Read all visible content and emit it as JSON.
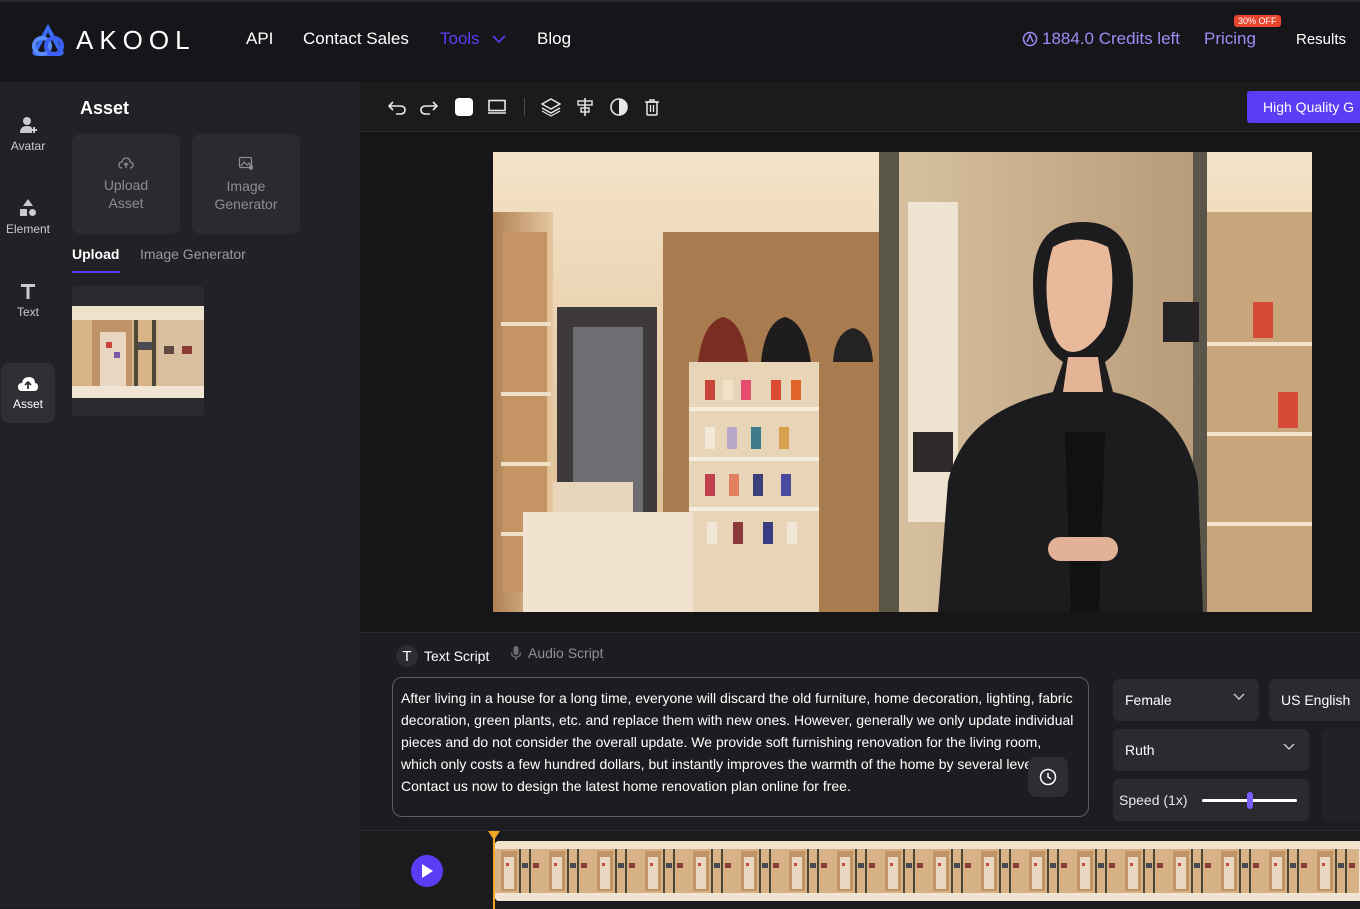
{
  "topbar": {
    "logo_text": "AKOOL",
    "nav": {
      "api": "API",
      "contact": "Contact Sales",
      "tools": "Tools",
      "blog": "Blog"
    },
    "credits": "1884.0 Credits left",
    "pricing": "Pricing",
    "pricing_badge": "30% OFF",
    "results": "Results"
  },
  "rail": {
    "items": [
      {
        "label": "Avatar",
        "icon": "avatar-icon"
      },
      {
        "label": "Element",
        "icon": "shapes-icon"
      },
      {
        "label": "Text",
        "icon": "text-icon"
      },
      {
        "label": "Asset",
        "icon": "cloud-upload-icon"
      }
    ]
  },
  "panel": {
    "title": "Asset",
    "cards": {
      "upload_l1": "Upload",
      "upload_l2": "Asset",
      "gen_l1": "Image",
      "gen_l2": "Generator"
    },
    "tabs": {
      "upload": "Upload",
      "image_gen": "Image Generator"
    }
  },
  "toolbar": {
    "hq_label": "High Quality G"
  },
  "script": {
    "tab_text": "Text Script",
    "tab_audio": "Audio Script",
    "text": "After living in a house for a long time, everyone will discard the old furniture, home decoration, lighting, fabric decoration, green plants, etc. and replace them with new ones. However, generally we only update individual pieces and do not consider the overall update. We provide soft furnishing renovation for the living room, which only costs a few hundred dollars, but instantly improves the warmth of the home by several levels! Contact us now to design the latest home renovation plan online for free."
  },
  "voice": {
    "gender": "Female",
    "language": "US English",
    "voice_name": "Ruth",
    "speed_label": "Speed (1x)",
    "speed_fraction": 0.5
  },
  "colors": {
    "accent": "#5b3df5",
    "credits": "#9d8cf6",
    "badge": "#e8452e",
    "playhead": "#f2a626"
  }
}
